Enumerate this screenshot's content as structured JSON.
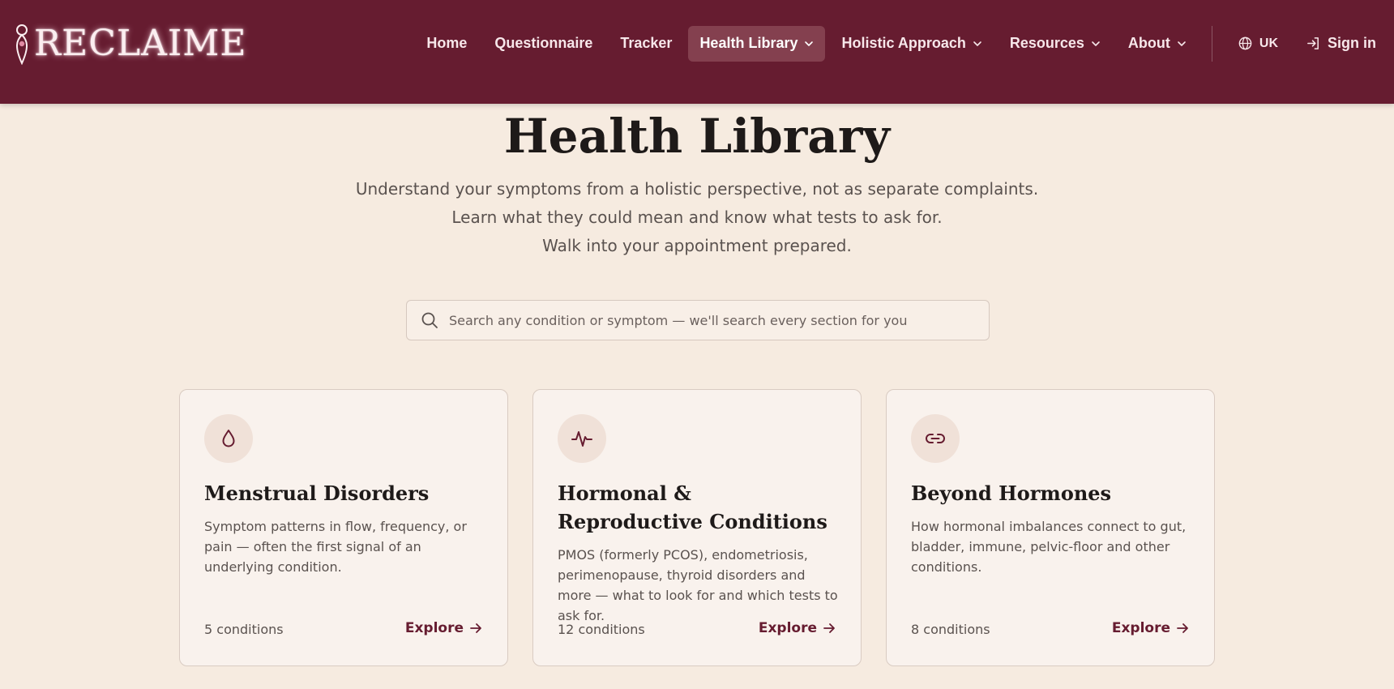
{
  "brand": {
    "name": "RECLAIME"
  },
  "nav": {
    "items": [
      {
        "label": "Home"
      },
      {
        "label": "Questionnaire"
      },
      {
        "label": "Tracker"
      },
      {
        "label": "Health Library"
      },
      {
        "label": "Holistic Approach"
      },
      {
        "label": "Resources"
      },
      {
        "label": "About"
      }
    ],
    "region": "UK",
    "sign_in": "Sign in"
  },
  "page": {
    "title": "Health Library",
    "subtitle_lines": [
      "Understand your symptoms from a holistic perspective, not as separate complaints.",
      "Learn what they could mean and know what tests to ask for.",
      "Walk into your appointment prepared."
    ]
  },
  "search": {
    "placeholder": "Search any condition or symptom — we'll search every section for you"
  },
  "cards": [
    {
      "icon": "droplet-icon",
      "title": "Menstrual Disorders",
      "description": "Symptom patterns in flow, frequency, or pain — often the first signal of an underlying condition.",
      "count": "5 conditions",
      "cta": "Explore"
    },
    {
      "icon": "activity-icon",
      "title": "Hormonal & Reproductive Conditions",
      "description": "PMOS (formerly PCOS), endometriosis, perimenopause, thyroid disorders and more — what to look for and which tests to ask for.",
      "count": "12 conditions",
      "cta": "Explore"
    },
    {
      "icon": "link-icon",
      "title": "Beyond Hormones",
      "description": "How hormonal imbalances connect to gut, bladder, immune, pelvic-floor and other conditions.",
      "count": "8 conditions",
      "cta": "Explore"
    }
  ],
  "colors": {
    "header_bg": "#661c30",
    "page_bg": "#f6ebe0",
    "accent": "#661c30"
  }
}
